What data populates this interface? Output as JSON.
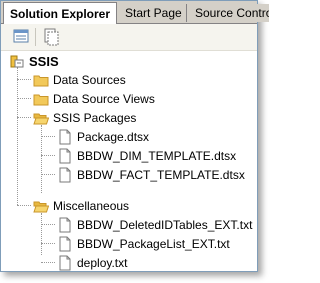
{
  "tabs": [
    {
      "label": "Solution Explorer",
      "active": true
    },
    {
      "label": "Start Page",
      "active": false
    },
    {
      "label": "Source Control",
      "active": false
    }
  ],
  "toolbar": {
    "buttons": [
      {
        "icon": "properties-icon"
      },
      {
        "icon": "show-all-files-icon"
      }
    ]
  },
  "tree": {
    "root": {
      "label": "SSIS",
      "icon": "project-icon"
    },
    "items": [
      {
        "label": "Data Sources",
        "icon": "folder-icon"
      },
      {
        "label": "Data Source Views",
        "icon": "folder-icon"
      },
      {
        "label": "SSIS Packages",
        "icon": "folder-open-icon"
      },
      {
        "label": "Package.dtsx",
        "icon": "file-icon"
      },
      {
        "label": "BBDW_DIM_TEMPLATE.dtsx",
        "icon": "file-icon"
      },
      {
        "label": "BBDW_FACT_TEMPLATE.dtsx",
        "icon": "file-icon"
      },
      {
        "label": "Miscellaneous",
        "icon": "folder-open-icon"
      },
      {
        "label": "BBDW_DeletedIDTables_EXT.txt",
        "icon": "file-icon"
      },
      {
        "label": "BBDW_PackageList_EXT.txt",
        "icon": "file-icon"
      },
      {
        "label": "deploy.txt",
        "icon": "file-icon"
      }
    ]
  },
  "colors": {
    "folder": "#f2c95a",
    "folder_dark": "#c9962a",
    "file_border": "#7a7a7a",
    "tab_bg": "#d4d0c8"
  }
}
